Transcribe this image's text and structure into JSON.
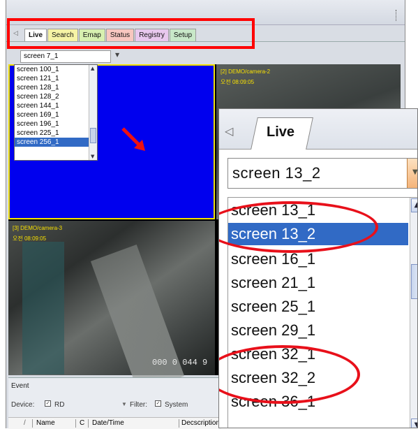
{
  "tabs": [
    {
      "label": "Live"
    },
    {
      "label": "Search"
    },
    {
      "label": "Emap"
    },
    {
      "label": "Status"
    },
    {
      "label": "Registry"
    },
    {
      "label": "Setup"
    }
  ],
  "screen_combo": {
    "value": "screen   7_1"
  },
  "screen_list": {
    "items": [
      "screen  100_1",
      "screen  121_1",
      "screen  128_1",
      "screen  128_2",
      "screen  144_1",
      "screen  169_1",
      "screen  196_1",
      "screen  225_1",
      "screen  256_1"
    ],
    "selected": "screen  256_1"
  },
  "cameras": [
    {
      "label": "[2]   DEMO/camera-2",
      "time": "오전 08:09:05"
    },
    {
      "label": "[3]   DEMO/camera-3",
      "time": "오전 08:09:05"
    }
  ],
  "camera_counter": "000  0  044  9",
  "event_panel": {
    "title": "Event",
    "device_label": "Device:",
    "device_value": "RD",
    "filter_label": "Filter:",
    "filter_value": "System",
    "columns": [
      "Name",
      "C",
      "Date/Time",
      "Decscription"
    ]
  },
  "zoom": {
    "tab_label": "Live",
    "combo_value": "screen   13_2",
    "items": [
      "screen   13_1",
      "screen   13_2",
      "screen   16_1",
      "screen   21_1",
      "screen   25_1",
      "screen   29_1",
      "screen   32_1",
      "screen   32_2",
      "screen   36_1"
    ],
    "selected": "screen   13_2"
  },
  "colors": {
    "highlight_red": "#ff0000",
    "selection_blue": "#316ac5",
    "camera_label_yellow": "#f8e000",
    "empty_cell_blue": "#0000ee"
  }
}
